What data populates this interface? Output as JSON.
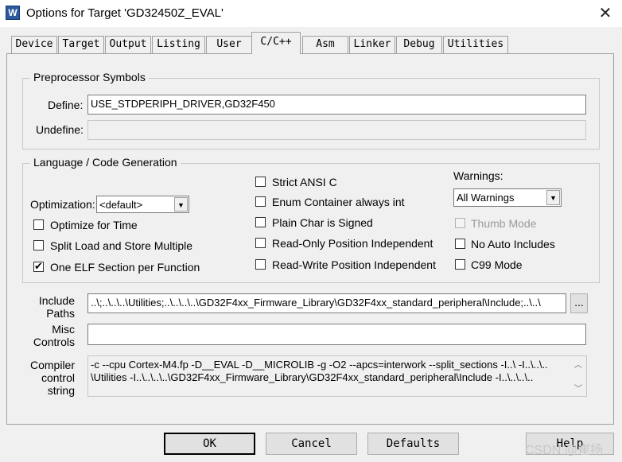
{
  "window": {
    "title": "Options for Target 'GD32450Z_EVAL'",
    "icon_text": "W",
    "close_glyph": "✕"
  },
  "tabs": [
    {
      "label": "Device"
    },
    {
      "label": "Target"
    },
    {
      "label": "Output"
    },
    {
      "label": "Listing"
    },
    {
      "label": "User"
    },
    {
      "label": "C/C++",
      "active": true
    },
    {
      "label": "Asm"
    },
    {
      "label": "Linker"
    },
    {
      "label": "Debug"
    },
    {
      "label": "Utilities"
    }
  ],
  "preprocessor": {
    "group_label": "Preprocessor Symbols",
    "define_label": "Define:",
    "define_value": "USE_STDPERIPH_DRIVER,GD32F450",
    "undefine_label": "Undefine:",
    "undefine_value": ""
  },
  "codegen": {
    "group_label": "Language / Code Generation",
    "optimization_label": "Optimization:",
    "optimization_value": "<default>",
    "warnings_label": "Warnings:",
    "warnings_value": "All Warnings",
    "options": {
      "optimize_time": {
        "label": "Optimize for Time",
        "checked": false
      },
      "split_load": {
        "label": "Split Load and Store Multiple",
        "checked": false
      },
      "one_elf": {
        "label": "One ELF Section per Function",
        "checked": true
      },
      "strict_ansi": {
        "label": "Strict ANSI C",
        "checked": false
      },
      "enum_container": {
        "label": "Enum Container always int",
        "checked": false
      },
      "plain_char": {
        "label": "Plain Char is Signed",
        "checked": false
      },
      "ro_position": {
        "label": "Read-Only Position Independent",
        "checked": false
      },
      "rw_position": {
        "label": "Read-Write Position Independent",
        "checked": false
      },
      "thumb_mode": {
        "label": "Thumb Mode",
        "checked": false,
        "disabled": true
      },
      "no_auto_includes": {
        "label": "No Auto Includes",
        "checked": false
      },
      "c99_mode": {
        "label": "C99 Mode",
        "checked": false
      }
    },
    "check_glyph": "✔"
  },
  "include_paths": {
    "label_line1": "Include",
    "label_line2": "Paths",
    "value": "..\\;..\\..\\..\\Utilities;..\\..\\..\\..\\GD32F4xx_Firmware_Library\\GD32F4xx_standard_peripheral\\Include;..\\..\\",
    "browse_label": "..."
  },
  "misc_controls": {
    "label_line1": "Misc",
    "label_line2": "Controls",
    "value": ""
  },
  "compiler_string": {
    "label_line1": "Compiler",
    "label_line2": "control",
    "label_line3": "string",
    "line1": "-c --cpu Cortex-M4.fp -D__EVAL -D__MICROLIB -g -O2 --apcs=interwork --split_sections -I..\\ -I..\\..\\..",
    "line2": "\\Utilities -I..\\..\\..\\..\\GD32F4xx_Firmware_Library\\GD32F4xx_standard_peripheral\\Include -I..\\..\\..\\.."
  },
  "buttons": {
    "ok": "OK",
    "cancel": "Cancel",
    "defaults": "Defaults",
    "help": "Help"
  },
  "watermark": "CSDN @崔扬"
}
